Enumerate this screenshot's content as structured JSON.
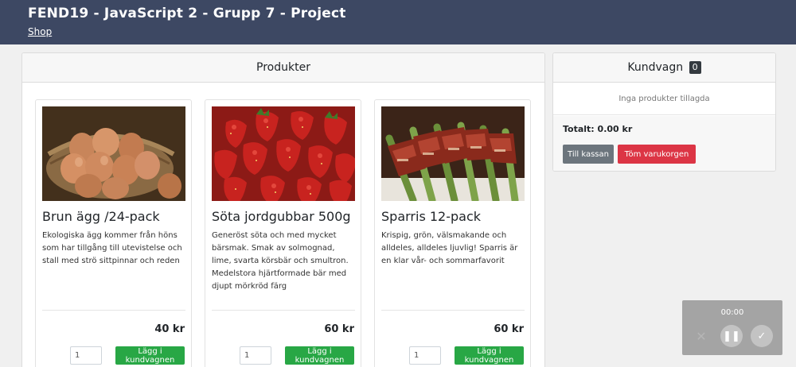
{
  "header": {
    "title": "FEND19 - JavaScript 2 - Grupp 7 - Project",
    "nav_link": "Shop"
  },
  "products_panel": {
    "title": "Produkter"
  },
  "products": [
    {
      "name": "Brun ägg /24-pack",
      "description": "Ekologiska ägg kommer från höns som har tillgång till utevistelse och stall med strö sittpinnar och reden",
      "price": "40 kr",
      "qty": "1",
      "add_label": "Lägg i kundvagnen",
      "image": "eggs-in-basket"
    },
    {
      "name": "Söta jordgubbar 500g",
      "description": "Generöst söta och med mycket bärsmak. Smak av solmognad, lime, svarta körsbär och smultron. Medelstora hjärtformade bär med djupt mörkröd färg",
      "price": "60 kr",
      "qty": "1",
      "add_label": "Lägg i kundvagnen",
      "image": "strawberries"
    },
    {
      "name": "Sparris 12-pack",
      "description": "Krispig, grön, välsmakande och alldeles, alldeles ljuvlig! Sparris är en klar vår- och sommarfavorit",
      "price": "60 kr",
      "qty": "1",
      "add_label": "Lägg i kundvagnen",
      "image": "asparagus-wrapped"
    }
  ],
  "cart": {
    "title": "Kundvagn",
    "count": "0",
    "empty_text": "Inga produkter tillagda",
    "total": "Totalt: 0.00 kr",
    "checkout_label": "Till kassan",
    "clear_label": "Töm varukorgen"
  },
  "recorder": {
    "time": "00:00"
  },
  "colors": {
    "header_bg": "#3d4863",
    "add_button": "#28a745",
    "clear_button": "#dc3545",
    "checkout_button": "#6c757d"
  }
}
